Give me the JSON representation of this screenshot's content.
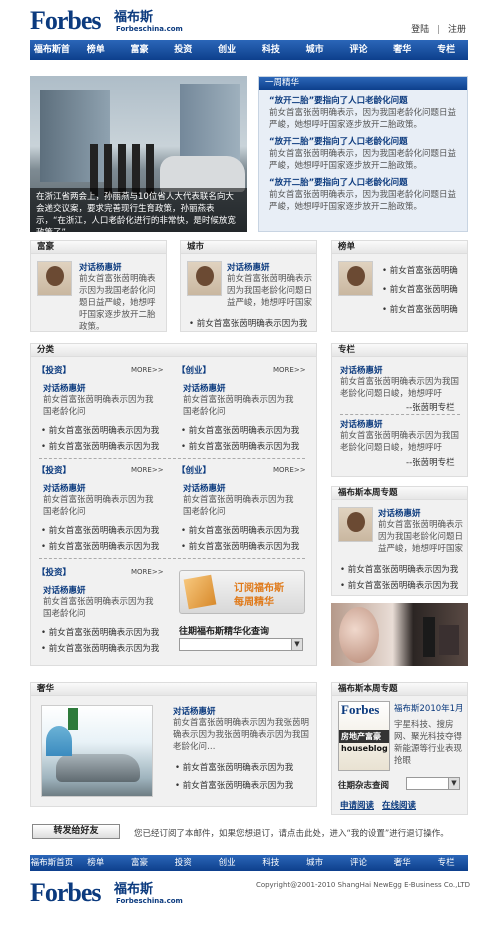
{
  "header": {
    "logo_text": "Forbes",
    "logo_cn": "福布斯",
    "logo_domain": "Forbeschina.com",
    "login": "登陆",
    "sep": "|",
    "register": "注册"
  },
  "nav": [
    "福布斯首页",
    "榜单",
    "富豪",
    "投资",
    "创业",
    "科技",
    "城市",
    "评论",
    "奢华",
    "专栏"
  ],
  "hero": {
    "caption": "在浙江省两会上，孙丽燕与10位省人大代表联名向大会递交议案，要求完善现行生育政策，孙丽燕表示，“在浙江，人口老龄化进行的非常快，是时候放宽政策了”"
  },
  "weekly": {
    "title": "一周精华",
    "items": [
      {
        "title": "“放开二胎”要指向了人口老龄化问题",
        "desc": "前女首富张茵明确表示，因为我国老龄化问题日益严峻，她想呼吁国家逐步放开二胎政策。"
      },
      {
        "title": "“放开二胎”要指向了人口老龄化问题",
        "desc": "前女首富张茵明确表示，因为我国老龄化问题日益严峻，她想呼吁国家逐步放开二胎政策。"
      },
      {
        "title": "“放开二胎”要指向了人口老龄化问题",
        "desc": "前女首富张茵明确表示，因为我国老龄化问题日益严峻，她想呼吁国家逐步放开二胎政策。"
      }
    ]
  },
  "rich": {
    "title": "富豪",
    "item_title": "对话杨惠妍",
    "desc": "前女首富张茵明确表示因为我国老龄化问题日益严峻，她想呼吁国家逐步放开二胎政策。"
  },
  "city": {
    "title": "城市",
    "item_title": "对话杨惠妍",
    "desc": "前女首富张茵明确表示因为我国老龄化问题日益严峻，她想呼吁国家",
    "bullet": "前女首富张茵明确表示因为我"
  },
  "ranking": {
    "title": "榜单",
    "bullets": [
      "前女首富张茵明确",
      "前女首富张茵明确",
      "前女首富张茵明确"
    ]
  },
  "category": {
    "title": "分类",
    "more": "MORE>>",
    "item_title": "对话杨惠妍",
    "desc": "前女首富张茵明确表示因为我国老龄化问",
    "bullet": "前女首富张茵明确表示因为我",
    "tags": [
      "【投资】",
      "【创业】",
      "【投资】",
      "【创业】",
      "【投资】"
    ]
  },
  "subscribe": {
    "line1": "订阅福布斯",
    "line2": "每周精华",
    "query": "往期福布斯精华化查询"
  },
  "column": {
    "title": "专栏",
    "item_title": "对话杨惠妍",
    "desc": "前女首富张茵明确表示因为我国老龄化问题日峻，她想呼吁",
    "sig": "--张茵明专栏"
  },
  "weekly_topic": {
    "title": "福布斯本周专题",
    "item_title": "对话杨惠妍",
    "desc": "前女首富张茵明确表示因为我国老龄化问题日益严峻，她想呼吁国家",
    "bullet": "前女首富张茵明确表示因为我"
  },
  "luxury": {
    "title": "奢华",
    "item_title": "对话杨惠妍",
    "desc": "前女首富张茵明确表示因为我张茵明确表示因为我张茵明确表示因为我国老龄化问…",
    "bullet": "前女首富张茵明确表示因为我"
  },
  "magazine": {
    "title": "福布斯本周专题",
    "issue": "福布斯2010年1月",
    "bullets": [
      "宇星科技、搜房网、聚光科技夺得新能源等行业表现抢眼"
    ],
    "select_label": "往期杂志查阅",
    "subscribe_read": "申请阅读",
    "online_read": "在线阅读",
    "cover_text": "房地产富豪",
    "cover_text2": "houseblog"
  },
  "forward": {
    "button": "转发给好友",
    "notice": "您已经订阅了本邮件，如果您想退订，请点击此处，进入“我的设置”进行退订操作。"
  },
  "footer_nav": [
    "福布斯首页",
    "榜单",
    "富豪",
    "投资",
    "创业",
    "科技",
    "城市",
    "评论",
    "奢华",
    "专栏"
  ],
  "copyright": "Copyright@2001-2010 ShangHai NewEgg E-Business Co.,LTD"
}
